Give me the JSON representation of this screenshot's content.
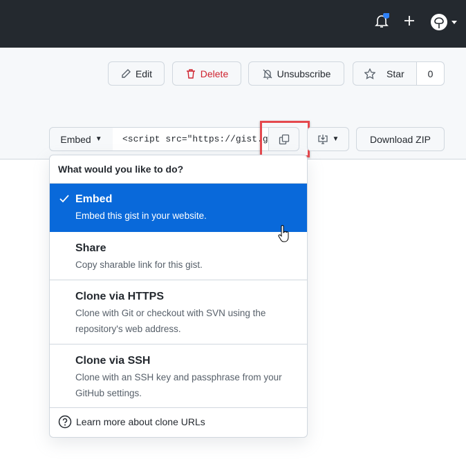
{
  "header": {
    "icons": [
      "bell-icon",
      "plus-icon",
      "avatar"
    ],
    "notification_color": "#2f81f7"
  },
  "actions": {
    "edit": "Edit",
    "delete": "Delete",
    "unsubscribe": "Unsubscribe",
    "star": "Star",
    "star_count": "0"
  },
  "clone": {
    "mode": "Embed",
    "value": "<script src=\"https://gist.github.com/",
    "download_zip": "Download ZIP"
  },
  "menu": {
    "header": "What would you like to do?",
    "items": [
      {
        "title": "Embed",
        "desc": "Embed this gist in your website."
      },
      {
        "title": "Share",
        "desc": "Copy sharable link for this gist."
      },
      {
        "title": "Clone via HTTPS",
        "desc": "Clone with Git or checkout with SVN using the repository's web address."
      },
      {
        "title": "Clone via SSH",
        "desc": "Clone with an SSH key and passphrase from your GitHub settings."
      }
    ],
    "footer": "Learn more about clone URLs"
  },
  "colors": {
    "accent": "#0969da",
    "danger": "#cf222e",
    "highlight": "#e5484d"
  }
}
